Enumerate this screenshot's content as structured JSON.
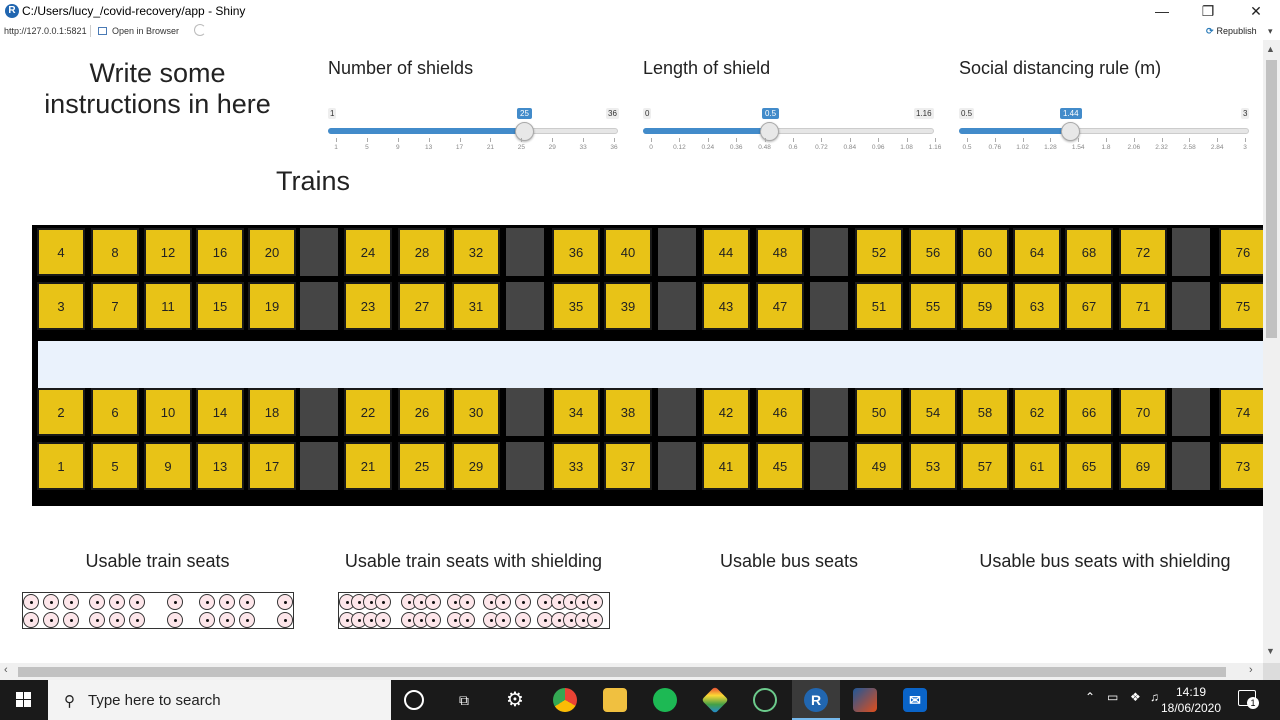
{
  "window": {
    "title": "C:/Users/lucy_/covid-recovery/app - Shiny",
    "url": "http://127.0.0.1:5821",
    "open_in_browser": "Open in Browser",
    "republish": "Republish"
  },
  "instructions": "Write some instructions in here",
  "sliders": [
    {
      "label": "Number of shields",
      "min": "1",
      "max": "36",
      "value": "25",
      "ticks": [
        "1",
        "5",
        "9",
        "13",
        "17",
        "21",
        "25",
        "29",
        "33",
        "36"
      ]
    },
    {
      "label": "Length of shield",
      "min": "0",
      "max": "1.16",
      "value": "0.5",
      "ticks": [
        "0",
        "0.12",
        "0.24",
        "0.36",
        "0.48",
        "0.6",
        "0.72",
        "0.84",
        "0.96",
        "1.08",
        "1.16"
      ]
    },
    {
      "label": "Social distancing rule (m)",
      "min": "0.5",
      "max": "3",
      "value": "1.44",
      "ticks": [
        "0.5",
        "0.76",
        "1.02",
        "1.28",
        "1.54",
        "1.8",
        "2.06",
        "2.32",
        "2.58",
        "2.84",
        "3"
      ]
    }
  ],
  "trains_title": "Trains",
  "train_rows": {
    "row1": [
      "4",
      "8",
      "12",
      "16",
      "20",
      "24",
      "28",
      "32",
      "36",
      "40",
      "44",
      "48",
      "52",
      "56",
      "60",
      "64",
      "68",
      "72",
      "76"
    ],
    "row2": [
      "3",
      "7",
      "11",
      "15",
      "19",
      "23",
      "27",
      "31",
      "35",
      "39",
      "43",
      "47",
      "51",
      "55",
      "59",
      "63",
      "67",
      "71",
      "75"
    ],
    "row3": [
      "2",
      "6",
      "10",
      "14",
      "18",
      "22",
      "26",
      "30",
      "34",
      "38",
      "42",
      "46",
      "50",
      "54",
      "58",
      "62",
      "66",
      "70",
      "74"
    ],
    "row4": [
      "1",
      "5",
      "9",
      "13",
      "17",
      "21",
      "25",
      "29",
      "33",
      "37",
      "41",
      "45",
      "49",
      "53",
      "57",
      "61",
      "65",
      "69",
      "73"
    ]
  },
  "usable": [
    "Usable train seats",
    "Usable train seats with shielding",
    "Usable bus seats",
    "Usable bus seats with shielding"
  ],
  "taskbar": {
    "search_placeholder": "Type here to search",
    "time": "14:19",
    "date": "18/06/2020",
    "notifications": "1"
  }
}
